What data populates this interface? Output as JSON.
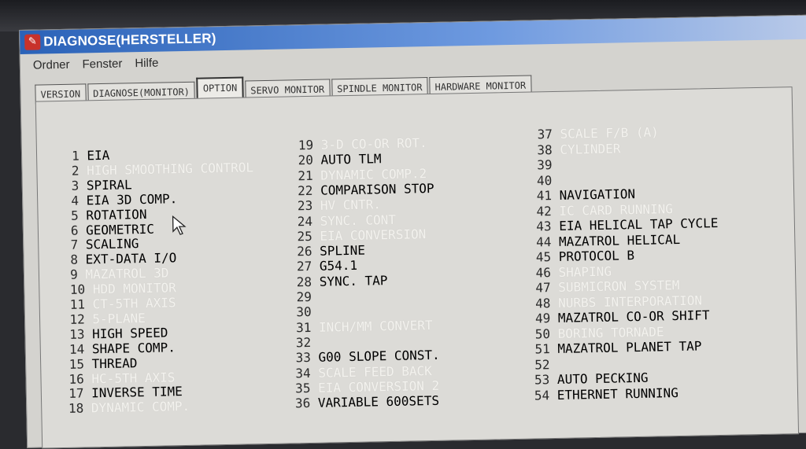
{
  "window": {
    "title": "DIAGNOSE(HERSTELLER)",
    "menu": [
      "Ordner",
      "Fenster",
      "Hilfe"
    ],
    "close_glyph": "X"
  },
  "tabs": [
    {
      "label": "VERSION",
      "active": false
    },
    {
      "label": "DIAGNOSE(MONITOR)",
      "active": false
    },
    {
      "label": "OPTION",
      "active": true
    },
    {
      "label": "SERVO MONITOR",
      "active": false
    },
    {
      "label": "SPINDLE MONITOR",
      "active": false
    },
    {
      "label": "HARDWARE MONITOR",
      "active": false
    }
  ],
  "options": [
    {
      "num": "1",
      "label": "EIA",
      "enabled": true
    },
    {
      "num": "2",
      "label": "HIGH SMOOTHING CONTROL",
      "enabled": false
    },
    {
      "num": "3",
      "label": "SPIRAL",
      "enabled": true
    },
    {
      "num": "4",
      "label": "EIA 3D COMP.",
      "enabled": true
    },
    {
      "num": "5",
      "label": "ROTATION",
      "enabled": true
    },
    {
      "num": "6",
      "label": "GEOMETRIC",
      "enabled": true
    },
    {
      "num": "7",
      "label": "SCALING",
      "enabled": true
    },
    {
      "num": "8",
      "label": "EXT-DATA I/O",
      "enabled": true
    },
    {
      "num": "9",
      "label": "MAZATROL 3D",
      "enabled": false
    },
    {
      "num": "10",
      "label": "HDD MONITOR",
      "enabled": false
    },
    {
      "num": "11",
      "label": "CT-5TH AXIS",
      "enabled": false
    },
    {
      "num": "12",
      "label": "5-PLANE",
      "enabled": false
    },
    {
      "num": "13",
      "label": "HIGH SPEED",
      "enabled": true
    },
    {
      "num": "14",
      "label": "SHAPE COMP.",
      "enabled": true
    },
    {
      "num": "15",
      "label": "THREAD",
      "enabled": true
    },
    {
      "num": "16",
      "label": "HC-5TH AXIS",
      "enabled": false
    },
    {
      "num": "17",
      "label": "INVERSE TIME",
      "enabled": true
    },
    {
      "num": "18",
      "label": "DYNAMIC COMP.",
      "enabled": false
    },
    {
      "num": "19",
      "label": "3-D CO-OR ROT.",
      "enabled": false
    },
    {
      "num": "20",
      "label": "AUTO TLM",
      "enabled": true
    },
    {
      "num": "21",
      "label": "DYNAMIC COMP.2",
      "enabled": false
    },
    {
      "num": "22",
      "label": "COMPARISON STOP",
      "enabled": true
    },
    {
      "num": "23",
      "label": "HV CNTR.",
      "enabled": false
    },
    {
      "num": "24",
      "label": "SYNC. CONT",
      "enabled": false
    },
    {
      "num": "25",
      "label": "EIA CONVERSION",
      "enabled": false
    },
    {
      "num": "26",
      "label": "SPLINE",
      "enabled": true
    },
    {
      "num": "27",
      "label": "G54.1",
      "enabled": true
    },
    {
      "num": "28",
      "label": "SYNC. TAP",
      "enabled": true
    },
    {
      "num": "29",
      "label": "",
      "enabled": true
    },
    {
      "num": "30",
      "label": "",
      "enabled": true
    },
    {
      "num": "31",
      "label": "INCH/MM CONVERT",
      "enabled": false
    },
    {
      "num": "32",
      "label": "",
      "enabled": true
    },
    {
      "num": "33",
      "label": "G00 SLOPE CONST.",
      "enabled": true
    },
    {
      "num": "34",
      "label": "SCALE FEED BACK",
      "enabled": false
    },
    {
      "num": "35",
      "label": "EIA CONVERSION 2",
      "enabled": false
    },
    {
      "num": "36",
      "label": "VARIABLE 600SETS",
      "enabled": true
    },
    {
      "num": "37",
      "label": "SCALE F/B (A)",
      "enabled": false
    },
    {
      "num": "38",
      "label": "CYLINDER",
      "enabled": false
    },
    {
      "num": "39",
      "label": "",
      "enabled": true
    },
    {
      "num": "40",
      "label": "",
      "enabled": true
    },
    {
      "num": "41",
      "label": "NAVIGATION",
      "enabled": true
    },
    {
      "num": "42",
      "label": "IC CARD RUNNING",
      "enabled": false
    },
    {
      "num": "43",
      "label": "EIA HELICAL TAP CYCLE",
      "enabled": true
    },
    {
      "num": "44",
      "label": "MAZATROL HELICAL",
      "enabled": true
    },
    {
      "num": "45",
      "label": "PROTOCOL B",
      "enabled": true
    },
    {
      "num": "46",
      "label": "SHAPING",
      "enabled": false
    },
    {
      "num": "47",
      "label": "SUBMICRON SYSTEM",
      "enabled": false
    },
    {
      "num": "48",
      "label": "NURBS INTERPORATION",
      "enabled": false
    },
    {
      "num": "49",
      "label": "MAZATROL CO-OR SHIFT",
      "enabled": true
    },
    {
      "num": "50",
      "label": "BORING TORNADE",
      "enabled": false
    },
    {
      "num": "51",
      "label": "MAZATROL PLANET TAP",
      "enabled": true
    },
    {
      "num": "52",
      "label": "",
      "enabled": true
    },
    {
      "num": "53",
      "label": "AUTO PECKING",
      "enabled": true
    },
    {
      "num": "54",
      "label": "ETHERNET RUNNING",
      "enabled": true
    }
  ]
}
